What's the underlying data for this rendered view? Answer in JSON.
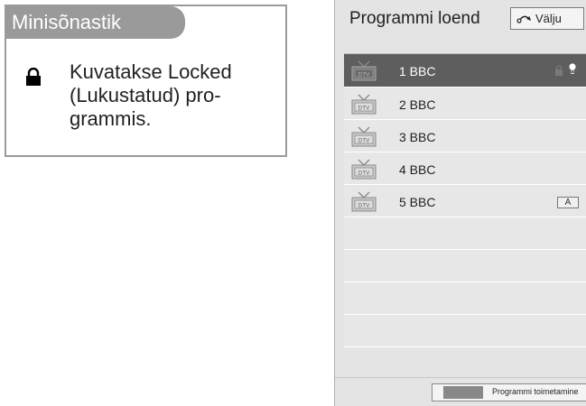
{
  "mini_dictionary": {
    "title": "Minisõnastik",
    "icon": "lock-icon",
    "lines": [
      "Kuvatakse Locked",
      "(Lukustatud) pro-",
      "grammis."
    ]
  },
  "program_list": {
    "title": "Programmi loend",
    "exit_button": {
      "icon": "return-icon",
      "label": "Välju"
    },
    "channels": [
      {
        "type_icon": "dtv-icon",
        "label": "1 BBC",
        "selected": true,
        "locked": true,
        "favourite": true
      },
      {
        "type_icon": "dtv-icon",
        "label": "2 BBC"
      },
      {
        "type_icon": "dtv-icon",
        "label": "3 BBC"
      },
      {
        "type_icon": "dtv-icon",
        "label": "4 BBC"
      },
      {
        "type_icon": "dtv-icon",
        "label": "5 BBC",
        "badge": "A"
      }
    ],
    "empty_rows": 4,
    "footer": {
      "color_key": "grey",
      "label": "Programmi toimetamine"
    }
  },
  "colors": {
    "frame_grey": "#9a9a9a",
    "panel_bg": "#e4e4e4",
    "selected_row": "#5e5e5e"
  }
}
